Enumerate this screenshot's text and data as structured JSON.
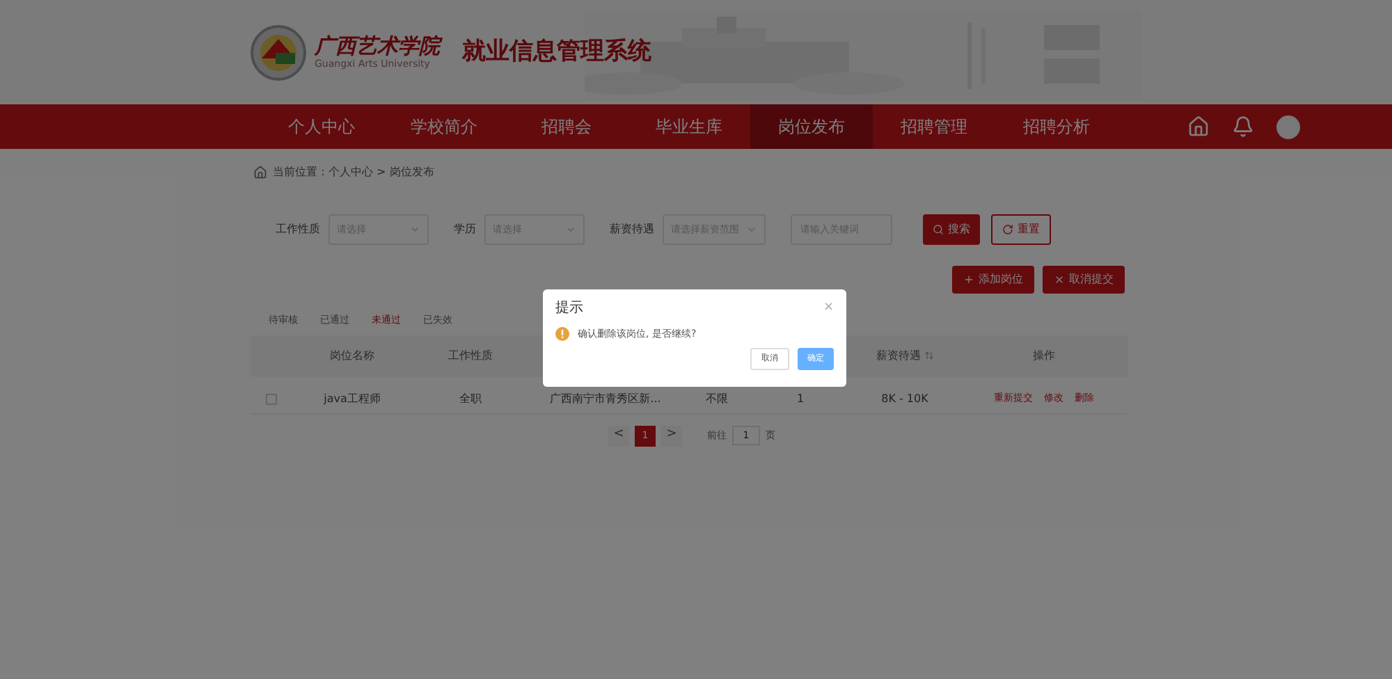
{
  "header": {
    "school_name": "广西艺术学院",
    "school_name_en": "Guangxi Arts University",
    "system_title": "就业信息管理系统"
  },
  "nav": [
    {
      "label": "个人中心",
      "selected": false
    },
    {
      "label": "学校简介",
      "selected": false
    },
    {
      "label": "招聘会",
      "selected": false
    },
    {
      "label": "毕业生库",
      "selected": false
    },
    {
      "label": "岗位发布",
      "selected": true
    },
    {
      "label": "招聘管理",
      "selected": false
    },
    {
      "label": "招聘分析",
      "selected": false
    }
  ],
  "breadcrumb": "当前位置：个人中心 > 岗位发布",
  "filters": [
    {
      "kind": "select",
      "label": "工作性质",
      "placeholder": "请选择"
    },
    {
      "kind": "select",
      "label": "学历",
      "placeholder": "请选择"
    },
    {
      "kind": "select",
      "label": "薪资待遇",
      "placeholder": "请选择薪资范围"
    },
    {
      "kind": "input",
      "placeholder": "请输入关键词"
    }
  ],
  "search_button": "搜索",
  "reset_button": "重置",
  "actions": [
    {
      "label": "添加岗位"
    },
    {
      "label": "取消提交"
    }
  ],
  "status_tabs": [
    {
      "label": "待审核",
      "selected": false
    },
    {
      "label": "已通过",
      "selected": false
    },
    {
      "label": "未通过",
      "selected": true
    },
    {
      "label": "已失效",
      "selected": false
    }
  ],
  "table": {
    "columns": [
      {
        "label": "岗位名称"
      },
      {
        "label": "工作性质"
      },
      {},
      {},
      {},
      {
        "label": "薪资待遇",
        "sortable": true
      },
      {
        "label": "操作"
      }
    ],
    "rows": [
      {
        "checked": false,
        "cells": [
          "java工程师",
          "全职",
          "广西南宁市青秀区新...",
          "不限",
          "1",
          "8K - 10K"
        ],
        "actions": [
          "重新提交",
          "修改",
          "删除"
        ]
      }
    ]
  },
  "pagination": {
    "prev": "<",
    "pages": [
      {
        "label": "1",
        "selected": true
      }
    ],
    "next": ">",
    "goto_label": "前往",
    "goto_value": "1",
    "page_unit": "页"
  },
  "dialog": {
    "title": "提示",
    "close": "×",
    "message": "确认删除该岗位, 是否继续?",
    "cancel": "取消",
    "confirm": "确定"
  }
}
